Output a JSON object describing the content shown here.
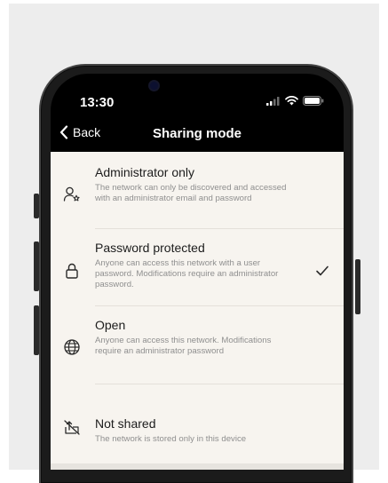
{
  "status": {
    "time": "13:30"
  },
  "nav": {
    "back_label": "Back",
    "title": "Sharing mode"
  },
  "options": [
    {
      "title": "Administrator only",
      "description": "The network can only be discovered and accessed with an administrator email and password",
      "icon": "admin-user-icon",
      "selected": false
    },
    {
      "title": "Password protected",
      "description": "Anyone can access this network with a user password. Modifications require an administrator password.",
      "icon": "lock-icon",
      "selected": true
    },
    {
      "title": "Open",
      "description": "Anyone can access this network. Modifications require an administrator password",
      "icon": "globe-icon",
      "selected": false
    },
    {
      "title": "Not shared",
      "description": "The network is stored only in this device",
      "icon": "not-shared-icon",
      "selected": false
    }
  ],
  "colors": {
    "screen_background": "#f7f4ef",
    "title_text": "#1c1c1c",
    "description_text": "#8f8f8f",
    "header_background": "#000000"
  }
}
